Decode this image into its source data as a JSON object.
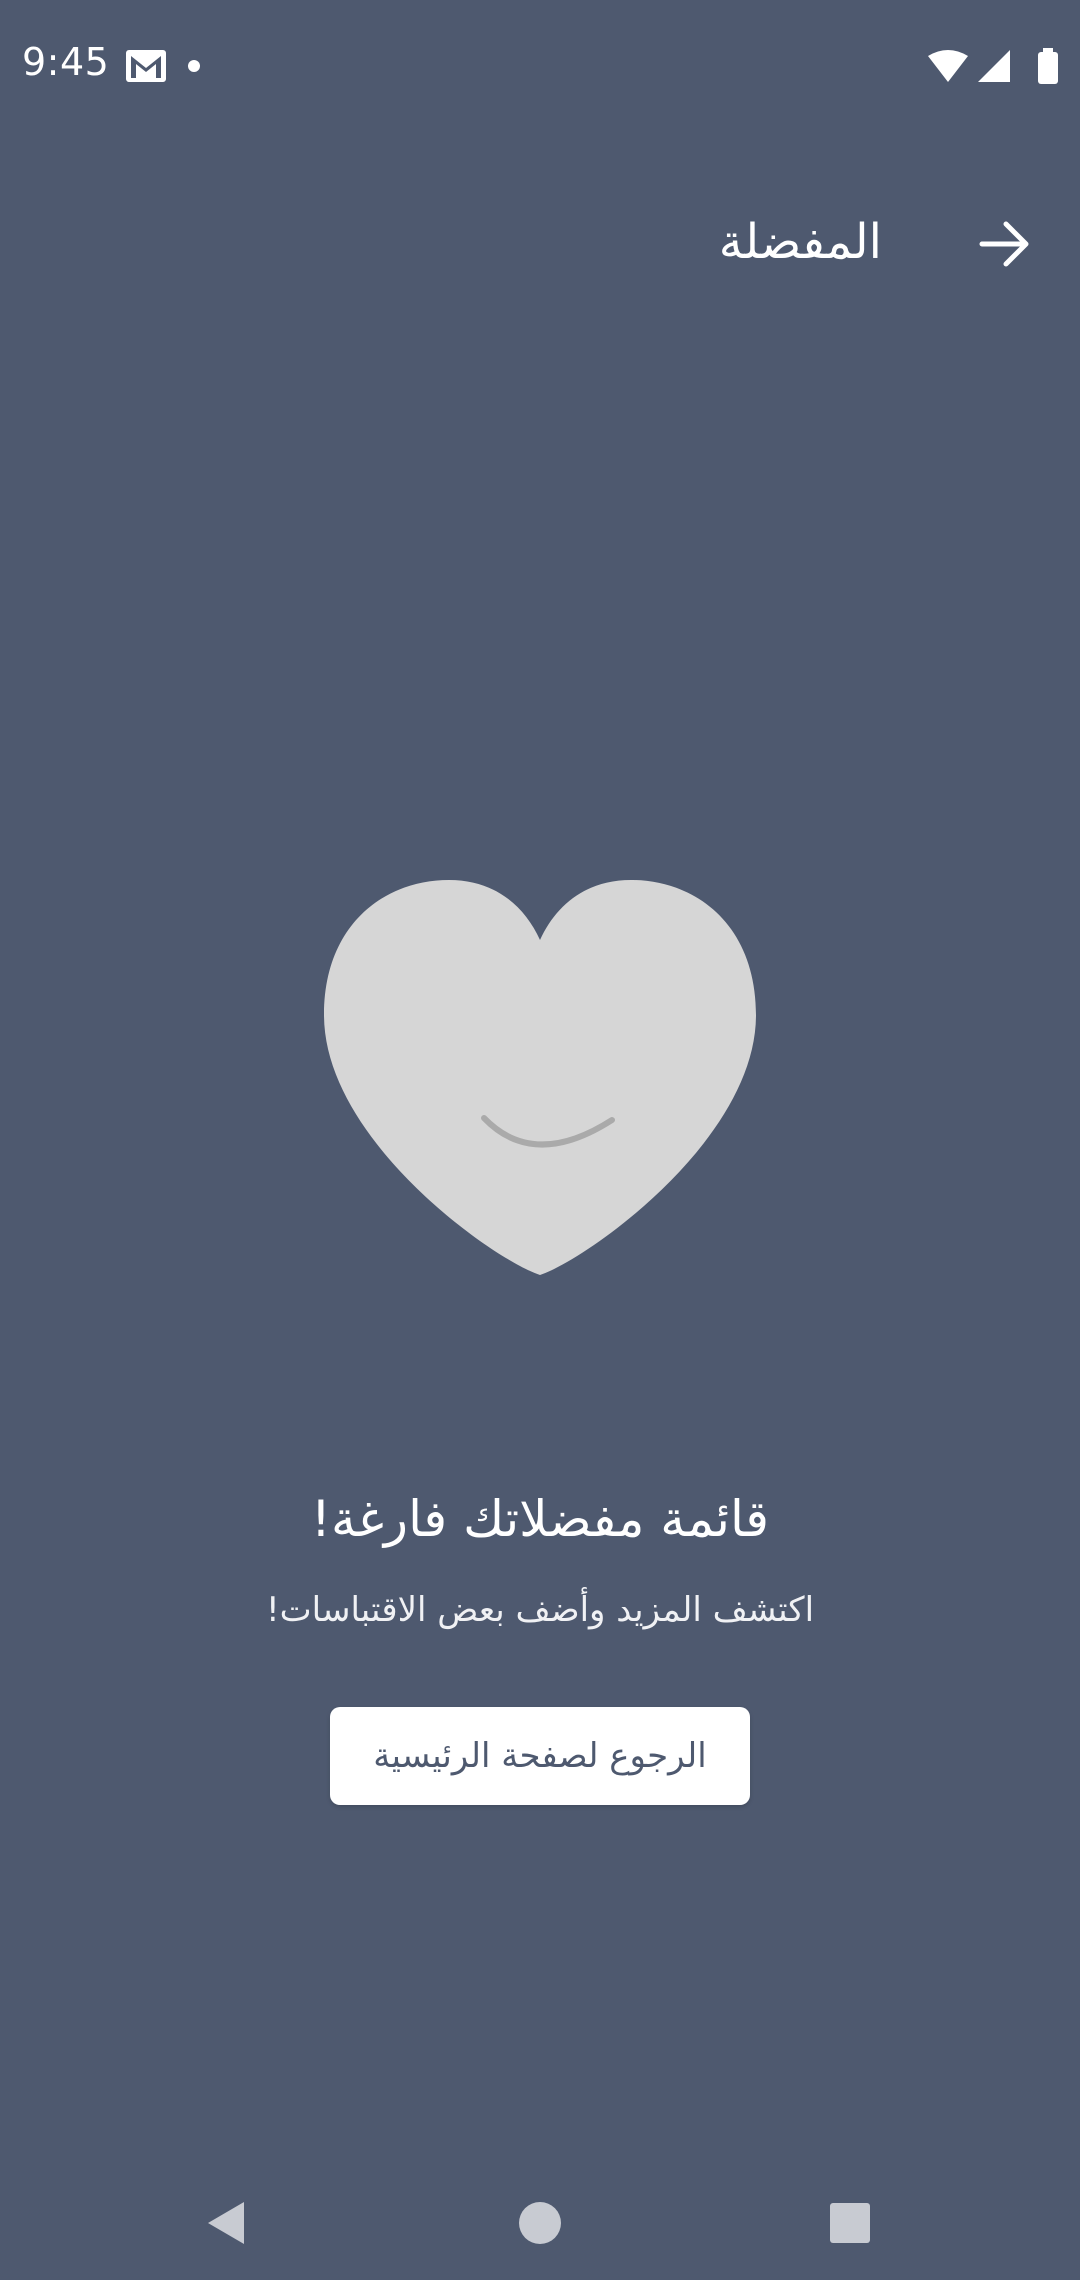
{
  "status_bar": {
    "time": "9:45",
    "icons": [
      "gmail-icon",
      "notification-dot-icon",
      "wifi-icon",
      "signal-icon",
      "battery-icon"
    ]
  },
  "app_bar": {
    "title": "المفضلة",
    "back_icon": "arrow-forward-icon"
  },
  "empty_state": {
    "illustration": "smiling-heart-icon",
    "title": "قائمة مفضلاتك فارغة!",
    "subtitle": "اكتشف المزيد وأضف بعض الاقتباسات!",
    "button_label": "الرجوع لصفحة الرئيسية"
  },
  "nav_bar": {
    "icons": [
      "nav-back-icon",
      "nav-home-icon",
      "nav-recents-icon"
    ]
  },
  "colors": {
    "background": "#4e596f",
    "heart": "#d6d6d6",
    "smile": "#aaaaaa",
    "button_bg": "#ffffff",
    "button_text": "#4e596f"
  }
}
